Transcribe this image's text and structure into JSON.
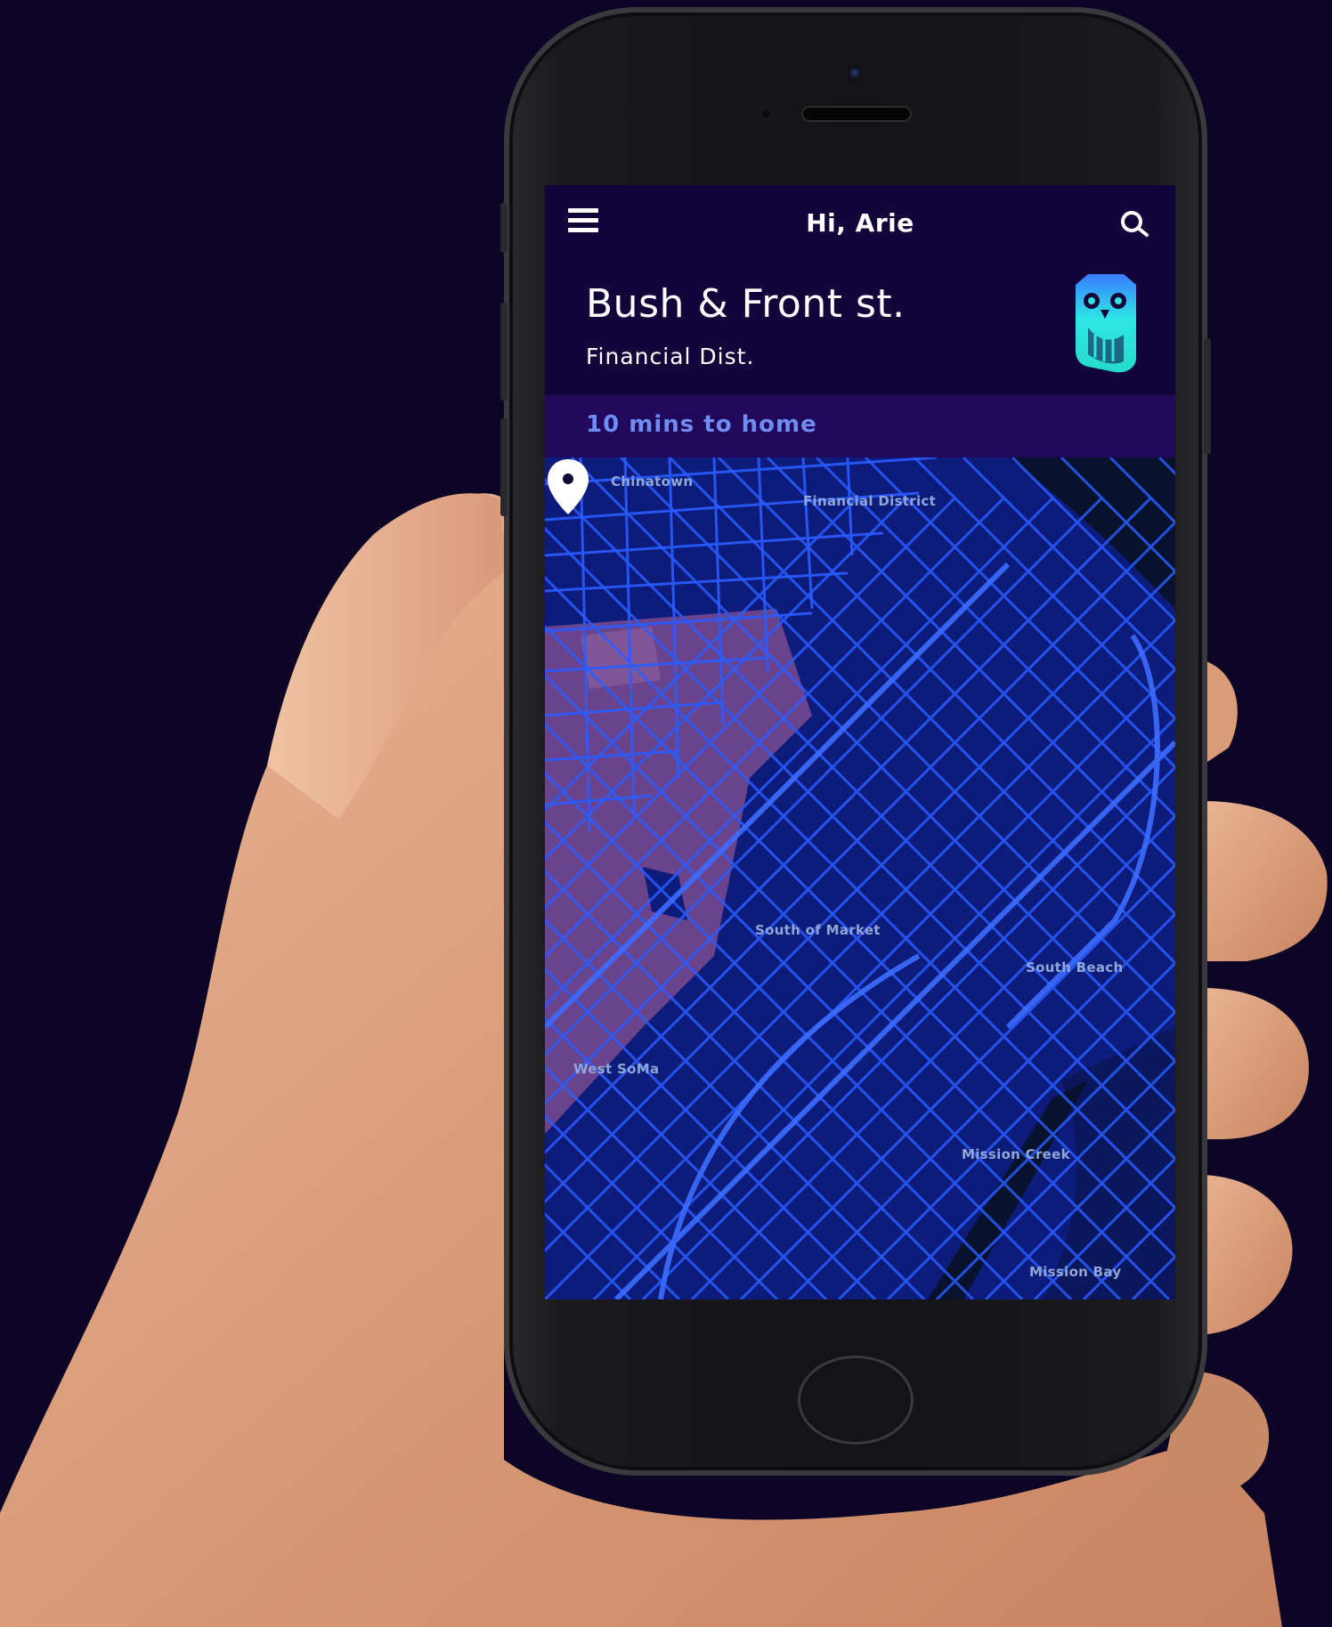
{
  "app": {
    "header": {
      "greeting": "Hi, Arie"
    },
    "location": {
      "street": "Bush & Front st.",
      "district": "Financial Dist."
    },
    "eta": {
      "text": "10 mins to home"
    },
    "map": {
      "labels": {
        "chinatown": "Chinatown",
        "financial_district": "Financial District",
        "south_of_market": "South of Market",
        "south_beach": "South Beach",
        "west_soma": "West SoMa",
        "mission_creek": "Mission Creek",
        "mission_bay": "Mission Bay"
      }
    }
  },
  "colors": {
    "background": "#0d0526",
    "screen": "#12053a",
    "eta_bar": "#21085a",
    "eta_text": "#6f8cf2",
    "map_base": "#0d1b7a",
    "map_streets": "#2a5cff",
    "heat_zone": "#7a4a8e",
    "owl_accent": "#2ee6e6"
  },
  "icons": [
    "menu-icon",
    "search-icon",
    "owl-logo-icon",
    "location-pin-icon"
  ]
}
